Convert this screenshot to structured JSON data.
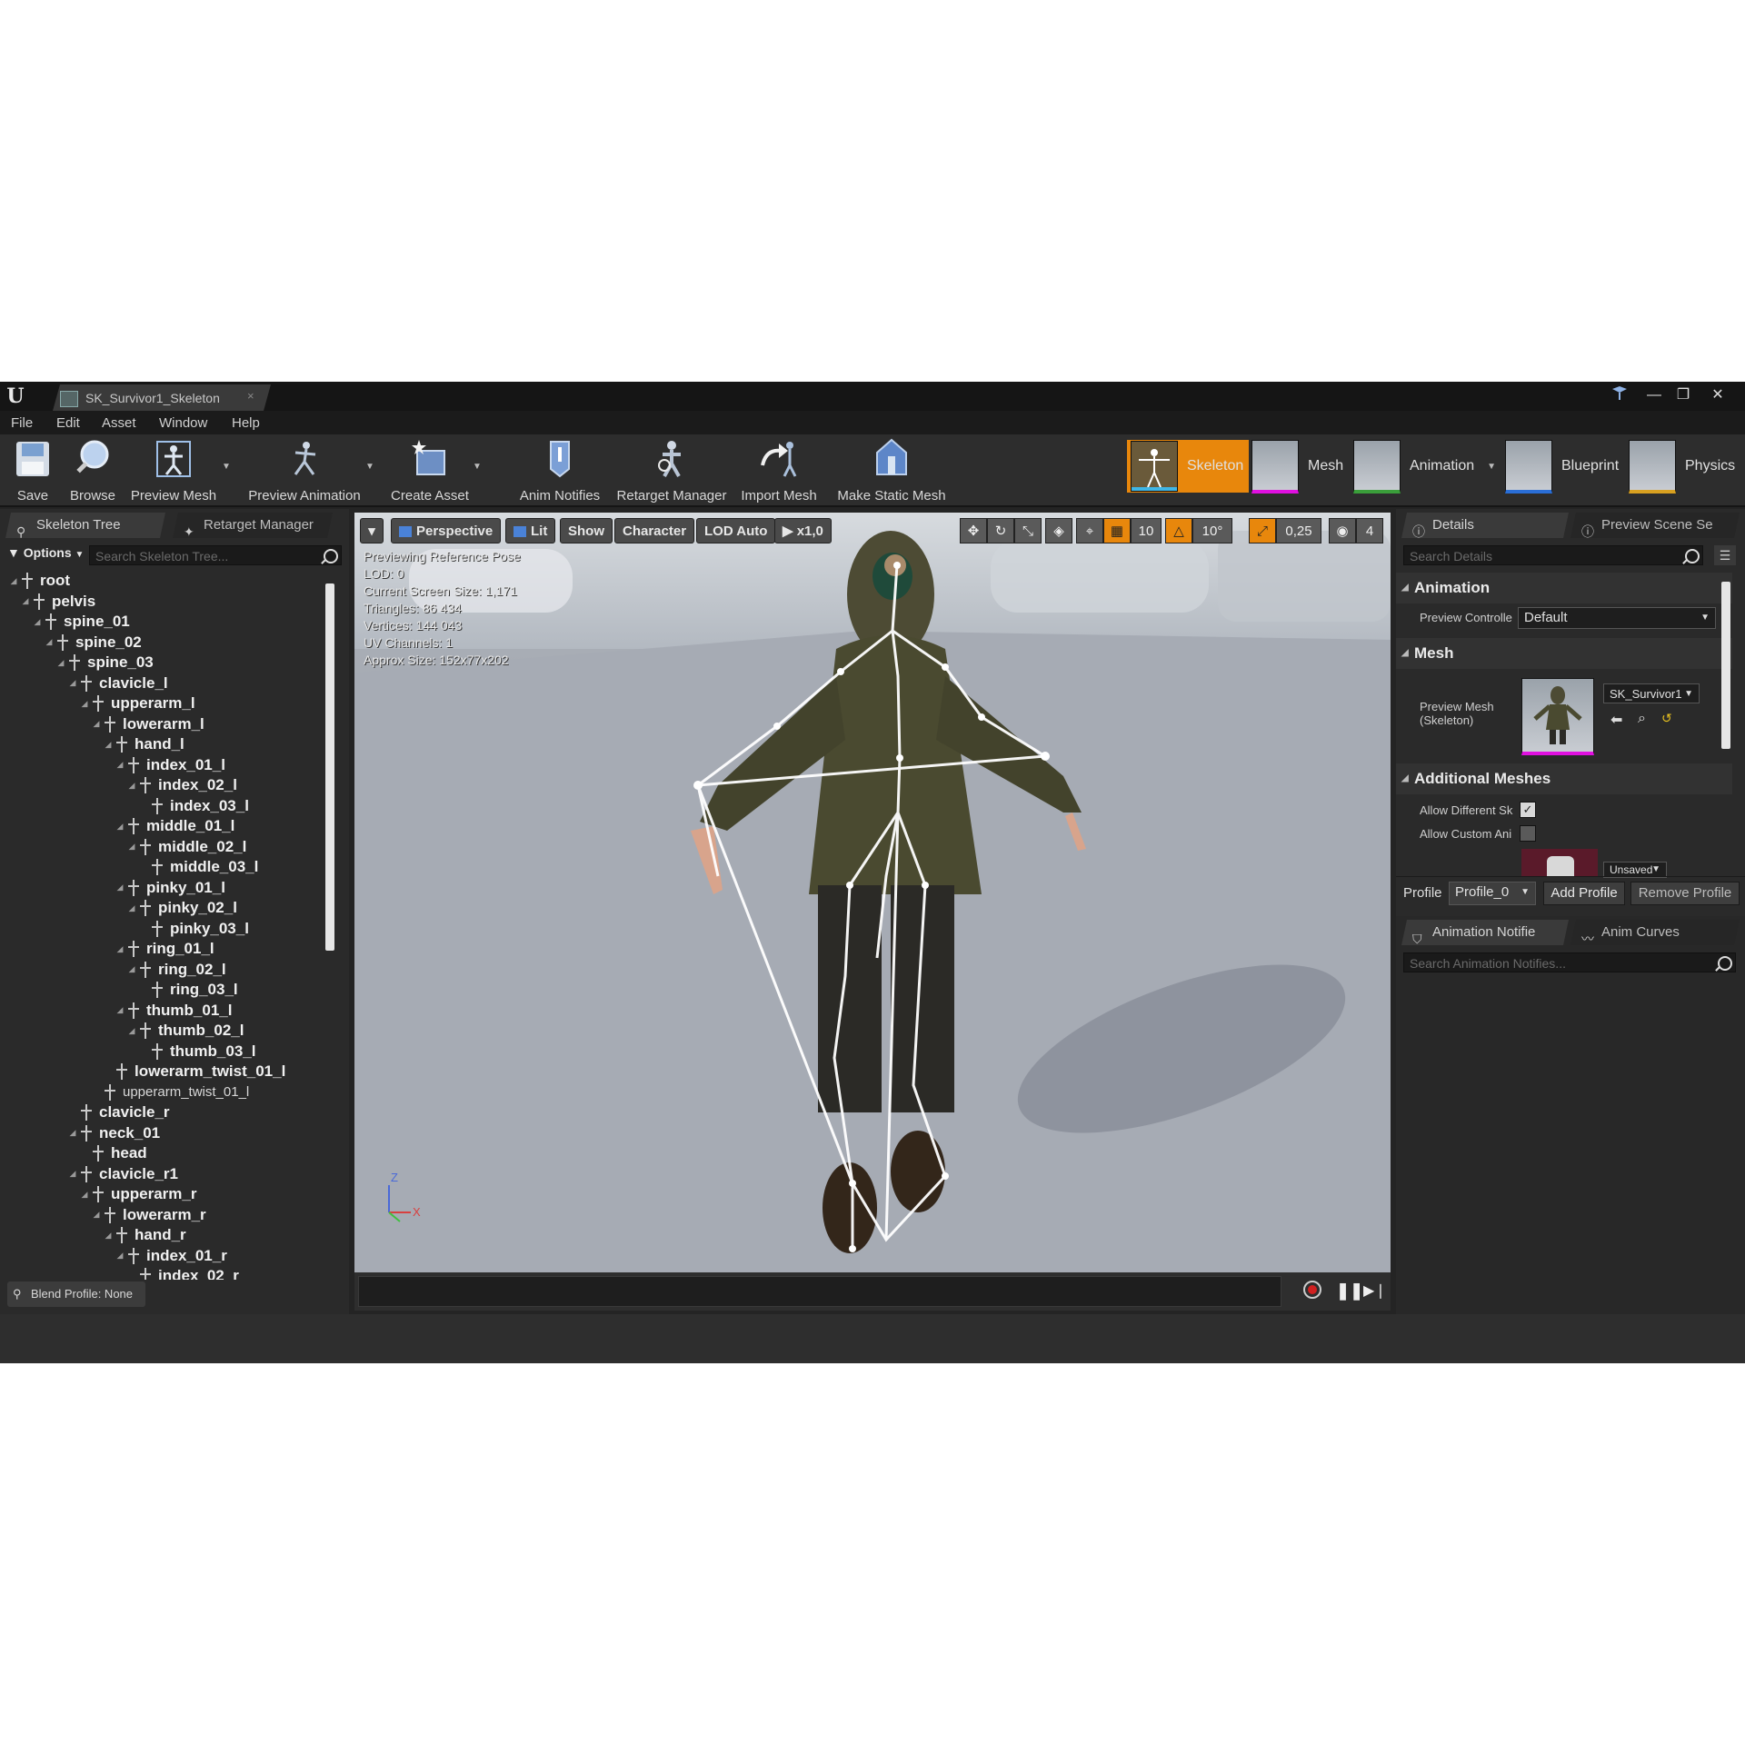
{
  "window": {
    "tab_title": "SK_Survivor1_Skeleton",
    "tab_close": "×",
    "logo": "U",
    "minimize": "—",
    "restore": "❐",
    "close": "✕"
  },
  "menu": [
    "File",
    "Edit",
    "Asset",
    "Window",
    "Help"
  ],
  "toolbar": {
    "buttons": [
      "Save",
      "Browse",
      "Preview Mesh",
      "Preview Animation",
      "Create Asset",
      "Anim Notifies",
      "Retarget Manager",
      "Import Mesh",
      "Make Static Mesh"
    ],
    "modes": [
      "Skeleton",
      "Mesh",
      "Animation",
      "Blueprint",
      "Physics"
    ],
    "active_mode": "Skeleton"
  },
  "skeleton_panel": {
    "tabs": [
      "Skeleton Tree",
      "Retarget Manager"
    ],
    "options_label": "Options",
    "search_placeholder": "Search Skeleton Tree...",
    "bones": [
      {
        "name": "root",
        "depth": 0
      },
      {
        "name": "pelvis",
        "depth": 1
      },
      {
        "name": "spine_01",
        "depth": 2
      },
      {
        "name": "spine_02",
        "depth": 3
      },
      {
        "name": "spine_03",
        "depth": 4
      },
      {
        "name": "clavicle_l",
        "depth": 5
      },
      {
        "name": "upperarm_l",
        "depth": 6
      },
      {
        "name": "lowerarm_l",
        "depth": 7
      },
      {
        "name": "hand_l",
        "depth": 8
      },
      {
        "name": "index_01_l",
        "depth": 9
      },
      {
        "name": "index_02_l",
        "depth": 10
      },
      {
        "name": "index_03_l",
        "depth": 11
      },
      {
        "name": "middle_01_l",
        "depth": 9
      },
      {
        "name": "middle_02_l",
        "depth": 10
      },
      {
        "name": "middle_03_l",
        "depth": 11
      },
      {
        "name": "pinky_01_l",
        "depth": 9
      },
      {
        "name": "pinky_02_l",
        "depth": 10
      },
      {
        "name": "pinky_03_l",
        "depth": 11
      },
      {
        "name": "ring_01_l",
        "depth": 9
      },
      {
        "name": "ring_02_l",
        "depth": 10
      },
      {
        "name": "ring_03_l",
        "depth": 11
      },
      {
        "name": "thumb_01_l",
        "depth": 9
      },
      {
        "name": "thumb_02_l",
        "depth": 10
      },
      {
        "name": "thumb_03_l",
        "depth": 11
      },
      {
        "name": "lowerarm_twist_01_l",
        "depth": 8
      },
      {
        "name": "upperarm_twist_01_l",
        "depth": 7,
        "small": true
      },
      {
        "name": "clavicle_r",
        "depth": 5
      },
      {
        "name": "neck_01",
        "depth": 5
      },
      {
        "name": "head",
        "depth": 6
      },
      {
        "name": "clavicle_r1",
        "depth": 5
      },
      {
        "name": "upperarm_r",
        "depth": 6
      },
      {
        "name": "lowerarm_r",
        "depth": 7
      },
      {
        "name": "hand_r",
        "depth": 8
      },
      {
        "name": "index_01_r",
        "depth": 9
      },
      {
        "name": "index_02_r",
        "depth": 10
      }
    ],
    "blend_profile": "Blend Profile: None"
  },
  "viewport": {
    "menu_arrow": "▾",
    "buttons": [
      "Perspective",
      "Lit",
      "Show",
      "Character",
      "LOD Auto",
      "x1,0"
    ],
    "stats": [
      "Previewing Reference Pose",
      "LOD: 0",
      "Current Screen Size: 1,171",
      "Triangles: 86 434",
      "Vertices: 144 043",
      "UV Channels: 1",
      "Approx Size: 152x77x202"
    ],
    "grid_snap": "10",
    "rotation_snap": "10°",
    "scale_snap": "0,25",
    "camera_speed": "4",
    "axis_z": "Z",
    "axis_x": "X"
  },
  "details_panel": {
    "tabs": [
      "Details",
      "Preview Scene Se"
    ],
    "search_placeholder": "Search Details",
    "sections": {
      "animation": "Animation",
      "mesh": "Mesh",
      "additional_meshes": "Additional Meshes"
    },
    "preview_controller_label": "Preview Controlle",
    "preview_controller_value": "Default",
    "preview_mesh_label_1": "Preview Mesh",
    "preview_mesh_label_2": "(Skeleton)",
    "preview_mesh_value": "SK_Survivor1",
    "allow_different_label": "Allow Different Sk",
    "allow_different_checked": true,
    "allow_custom_label": "Allow Custom Ani",
    "allow_custom_checked": false,
    "unsaved_label": "Unsaved",
    "profile_label": "Profile",
    "profile_value": "Profile_0",
    "add_profile": "Add Profile",
    "remove_profile": "Remove Profile"
  },
  "notifies_panel": {
    "tabs": [
      "Animation Notifie",
      "Anim Curves"
    ],
    "search_placeholder": "Search Animation Notifies..."
  },
  "colors": {
    "accent_orange": "#e8870c",
    "panel_bg": "#2a2a2a",
    "magenta_underline": "#e010e0"
  }
}
